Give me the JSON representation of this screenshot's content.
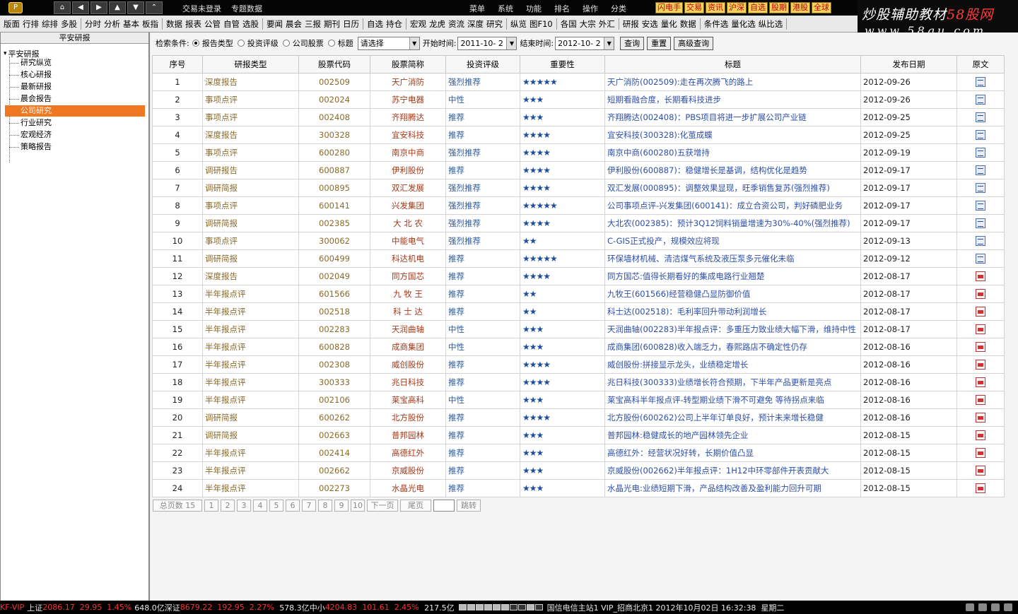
{
  "titlebar": {
    "logo_text": "P",
    "nav_buttons": [
      "⌂",
      "◀",
      "▶",
      "▲",
      "▼",
      "⌃"
    ],
    "links": [
      "交易未登录",
      "专题数据"
    ],
    "menus": [
      "菜单",
      "系统",
      "功能",
      "排名",
      "操作",
      "分类"
    ],
    "tags": [
      "闪电手",
      "交易",
      "资讯",
      "沪深",
      "自选",
      "股期",
      "港股",
      "全球"
    ]
  },
  "toolbar": {
    "groups": [
      [
        "版面",
        "行排",
        "综排",
        "多股"
      ],
      [
        "分时",
        "分析",
        "基本",
        "板指"
      ],
      [
        "数据",
        "报表",
        "公管",
        "自管",
        "选股"
      ],
      [
        "要闻",
        "晨会",
        "三报",
        "期刊",
        "日历"
      ],
      [
        "自选",
        "持仓"
      ],
      [
        "宏观",
        "龙虎",
        "资流",
        "深度",
        "研究"
      ],
      [
        "纵览",
        "图F10"
      ],
      [
        "各国",
        "大宗",
        "外汇"
      ],
      [
        "研报",
        "安选",
        "量化",
        "数据"
      ],
      [
        "条件选",
        "量化选",
        "纵比选"
      ]
    ]
  },
  "watermark": {
    "line1_a": "炒股辅助教材",
    "line1_b": "58股网",
    "line2": "www.58gu.com"
  },
  "left_panel": {
    "title": "平安研报",
    "root": "平安研报",
    "items": [
      "研究纵览",
      "核心研报",
      "最新研报",
      "晨会报告",
      "公司研究",
      "行业研究",
      "宏观经济",
      "策略报告"
    ],
    "selected_index": 4
  },
  "filter": {
    "label": "检索条件:",
    "radios": [
      "报告类型",
      "投资评级",
      "公司股票",
      "标题"
    ],
    "selected_radio": 0,
    "select_value": "请选择",
    "start_label": "开始时间:",
    "start_value": "2011-10- 2",
    "end_label": "结束时间:",
    "end_value": "2012-10- 2",
    "buttons": [
      "查询",
      "重置",
      "高级查询"
    ]
  },
  "table": {
    "headers": [
      "序号",
      "研报类型",
      "股票代码",
      "股票简称",
      "投资评级",
      "重要性",
      "标题",
      "发布日期",
      "原文"
    ],
    "rows": [
      {
        "no": "1",
        "type": "深度报告",
        "code": "002509",
        "name": "天广消防",
        "rating": "强烈推荐",
        "stars": "★★★★★",
        "title": "天广消防(002509):走在再次腾飞的路上",
        "date": "2012-09-26",
        "icon": "doc"
      },
      {
        "no": "2",
        "type": "事项点评",
        "code": "002024",
        "name": "苏宁电器",
        "rating": "中性",
        "stars": "★★★",
        "title": "短期看融合度，长期看科技进步",
        "date": "2012-09-26",
        "icon": "doc"
      },
      {
        "no": "3",
        "type": "事项点评",
        "code": "002408",
        "name": "齐翔腾达",
        "rating": "推荐",
        "stars": "★★★",
        "title": "齐翔腾达(002408)：PBS项目将进一步扩展公司产业链",
        "date": "2012-09-25",
        "icon": "doc"
      },
      {
        "no": "4",
        "type": "深度报告",
        "code": "300328",
        "name": "宜安科技",
        "rating": "推荐",
        "stars": "★★★★",
        "title": "宜安科技(300328):化茧成蝶",
        "date": "2012-09-25",
        "icon": "doc"
      },
      {
        "no": "5",
        "type": "事项点评",
        "code": "600280",
        "name": "南京中商",
        "rating": "强烈推荐",
        "stars": "★★★★",
        "title": "南京中商(600280)五获增持",
        "date": "2012-09-19",
        "icon": "doc"
      },
      {
        "no": "6",
        "type": "调研报告",
        "code": "600887",
        "name": "伊利股份",
        "rating": "推荐",
        "stars": "★★★★",
        "title": "伊利股份(600887)：稳健增长是基调，结构优化是趋势",
        "date": "2012-09-17",
        "icon": "doc"
      },
      {
        "no": "7",
        "type": "调研简报",
        "code": "000895",
        "name": "双汇发展",
        "rating": "强烈推荐",
        "stars": "★★★★",
        "title": "双汇发展(000895)：调整效果显现，旺季销售复苏(强烈推荐)",
        "date": "2012-09-17",
        "icon": "doc"
      },
      {
        "no": "8",
        "type": "事项点评",
        "code": "600141",
        "name": "兴发集团",
        "rating": "强烈推荐",
        "stars": "★★★★★",
        "title": "公司事项点评-兴发集团(600141)：成立合资公司，判好磷肥业务",
        "date": "2012-09-17",
        "icon": "doc"
      },
      {
        "no": "9",
        "type": "调研简报",
        "code": "002385",
        "name": "大 北 农",
        "rating": "强烈推荐",
        "stars": "★★★★",
        "title": "大北农(002385)：预计3Q12饲料销量增速为30%-40%(强烈推荐)",
        "date": "2012-09-17",
        "icon": "doc"
      },
      {
        "no": "10",
        "type": "事项点评",
        "code": "300062",
        "name": "中能电气",
        "rating": "强烈推荐",
        "stars": "★★",
        "title": "C-GIS正式投产，规模效应将现",
        "date": "2012-09-13",
        "icon": "doc"
      },
      {
        "no": "11",
        "type": "调研简报",
        "code": "600499",
        "name": "科达机电",
        "rating": "推荐",
        "stars": "★★★★★",
        "title": "环保墙材机械、清洁煤气系统及液压泵多元催化未临",
        "date": "2012-09-12",
        "icon": "doc"
      },
      {
        "no": "12",
        "type": "深度报告",
        "code": "002049",
        "name": "同方国芯",
        "rating": "推荐",
        "stars": "★★★★",
        "title": "同方国芯:值得长期看好的集成电路行业翘楚",
        "date": "2012-08-17",
        "icon": "pdf"
      },
      {
        "no": "13",
        "type": "半年报点评",
        "code": "601566",
        "name": "九 牧 王",
        "rating": "推荐",
        "stars": "★★",
        "title": "九牧王(601566)经营稳健凸显防御价值",
        "date": "2012-08-17",
        "icon": "pdf"
      },
      {
        "no": "14",
        "type": "半年报点评",
        "code": "002518",
        "name": "科 士 达",
        "rating": "推荐",
        "stars": "★★",
        "title": "科士达(002518)：毛利率回升带动利润增长",
        "date": "2012-08-17",
        "icon": "pdf"
      },
      {
        "no": "15",
        "type": "半年报点评",
        "code": "002283",
        "name": "天润曲轴",
        "rating": "中性",
        "stars": "★★★",
        "title": "天润曲轴(002283)半年报点评：多重压力致业绩大幅下滑，维持中性",
        "date": "2012-08-17",
        "icon": "pdf"
      },
      {
        "no": "16",
        "type": "半年报点评",
        "code": "600828",
        "name": "成商集团",
        "rating": "中性",
        "stars": "★★★",
        "title": "成商集团(600828)收入端乏力，春熙路店不确定性仍存",
        "date": "2012-08-16",
        "icon": "pdf"
      },
      {
        "no": "17",
        "type": "半年报点评",
        "code": "002308",
        "name": "威创股份",
        "rating": "推荐",
        "stars": "★★★★",
        "title": "威创股份:拼接显示龙头，业绩稳定增长",
        "date": "2012-08-16",
        "icon": "pdf"
      },
      {
        "no": "18",
        "type": "半年报点评",
        "code": "300333",
        "name": "兆日科技",
        "rating": "推荐",
        "stars": "★★★★",
        "title": "兆日科技(300333)业绩增长符合预期，下半年产品更新是亮点",
        "date": "2012-08-16",
        "icon": "pdf"
      },
      {
        "no": "19",
        "type": "半年报点评",
        "code": "002106",
        "name": "莱宝高科",
        "rating": "中性",
        "stars": "★★★",
        "title": "莱宝高科半年报点评-转型期业绩下滑不可避免 等待拐点来临",
        "date": "2012-08-16",
        "icon": "pdf"
      },
      {
        "no": "20",
        "type": "调研简报",
        "code": "600262",
        "name": "北方股份",
        "rating": "推荐",
        "stars": "★★★★",
        "title": "北方股份(600262)公司上半年订单良好，预计未来增长稳健",
        "date": "2012-08-16",
        "icon": "pdf"
      },
      {
        "no": "21",
        "type": "调研简报",
        "code": "002663",
        "name": "普邦园林",
        "rating": "推荐",
        "stars": "★★★",
        "title": "普邦园林:稳健成长的地产园林领先企业",
        "date": "2012-08-15",
        "icon": "pdf"
      },
      {
        "no": "22",
        "type": "半年报点评",
        "code": "002414",
        "name": "高德红外",
        "rating": "推荐",
        "stars": "★★★",
        "title": "高德红外：经营状况好转，长期价值凸显",
        "date": "2012-08-15",
        "icon": "pdf"
      },
      {
        "no": "23",
        "type": "半年报点评",
        "code": "002662",
        "name": "京威股份",
        "rating": "推荐",
        "stars": "★★★",
        "title": "京威股份(002662)半年报点评：1H12中环零部件开表贡献大",
        "date": "2012-08-15",
        "icon": "pdf"
      },
      {
        "no": "24",
        "type": "半年报点评",
        "code": "002273",
        "name": "水晶光电",
        "rating": "推荐",
        "stars": "★★★",
        "title": "水晶光电:业绩短期下滑，产品结构改善及盈利能力回升可期",
        "date": "2012-08-15",
        "icon": "pdf"
      }
    ]
  },
  "pager": {
    "total_label": "总页数",
    "total": "15",
    "pages": [
      "1",
      "2",
      "3",
      "4",
      "5",
      "6",
      "7",
      "8",
      "9",
      "10"
    ],
    "next": "下一页",
    "last": "尾页",
    "goto": "跳转"
  },
  "statusbar": {
    "vip": "KF-VIP",
    "sh_label": "上证",
    "sh_index": "2086.17",
    "sh_change": "29.95",
    "sh_pct": "1.45%",
    "sh_amount": "648.0亿",
    "sz_label": "深证",
    "sz_index": "8679.22",
    "sz_change": "192.95",
    "sz_pct": "2.27%",
    "sz_amount": "578.3亿",
    "zx_label": "中小",
    "zx_index": "4204.83",
    "zx_change": "101.61",
    "zx_pct": "2.45%",
    "zx_amount": "217.5亿",
    "server": "国信电信主站1 VIP_招商北京1",
    "datetime": "2012年10月02日 16:32:38",
    "weekday": "星期二"
  }
}
